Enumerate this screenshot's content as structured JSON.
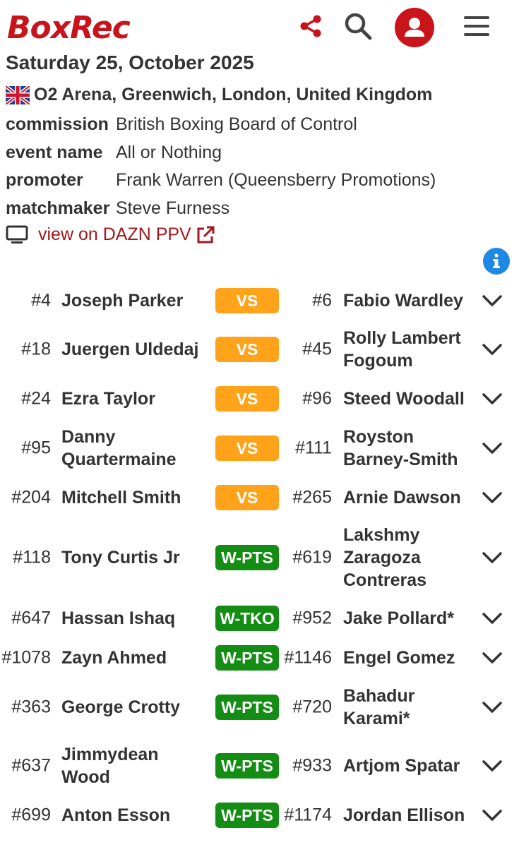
{
  "header": {
    "logo": "BoxRec",
    "icons": [
      "share-icon",
      "search-icon",
      "user-icon",
      "menu-icon"
    ],
    "brand_color": "#c8141a"
  },
  "event": {
    "date": "Saturday 25, October 2025",
    "venue": "O2 Arena, Greenwich, London, United Kingdom",
    "fields": [
      {
        "key": "commission",
        "value": "British Boxing Board of Control"
      },
      {
        "key": "event name",
        "value": "All or Nothing"
      },
      {
        "key": "promoter",
        "value": "Frank Warren (Queensberry Promotions)"
      },
      {
        "key": "matchmaker",
        "value": "Steve Furness"
      }
    ],
    "stream_link": "view on DAZN PPV"
  },
  "colors": {
    "vs": "#ffa31a",
    "win": "#138d13",
    "info": "#1e88e5",
    "link": "#a3171c"
  },
  "bouts": [
    {
      "r1": "#4",
      "n1": "Joseph Parker",
      "result": "VS",
      "r2": "#6",
      "n2": "Fabio Wardley"
    },
    {
      "r1": "#18",
      "n1": "Juergen Uldedaj",
      "result": "VS",
      "r2": "#45",
      "n2": "Rolly Lambert Fogoum"
    },
    {
      "r1": "#24",
      "n1": "Ezra Taylor",
      "result": "VS",
      "r2": "#96",
      "n2": "Steed Woodall"
    },
    {
      "r1": "#95",
      "n1": "Danny Quartermaine",
      "result": "VS",
      "r2": "#111",
      "n2": "Royston Barney-Smith"
    },
    {
      "r1": "#204",
      "n1": "Mitchell Smith",
      "result": "VS",
      "r2": "#265",
      "n2": "Arnie Dawson"
    },
    {
      "r1": "#118",
      "n1": "Tony Curtis Jr",
      "result": "W-PTS",
      "r2": "#619",
      "n2": "Lakshmy Zaragoza Contreras"
    },
    {
      "r1": "#647",
      "n1": "Hassan Ishaq",
      "result": "W-TKO",
      "r2": "#952",
      "n2": "Jake Pollard*"
    },
    {
      "r1": "#1078",
      "n1": "Zayn Ahmed",
      "result": "W-PTS",
      "r2": "#1146",
      "n2": "Engel Gomez"
    },
    {
      "r1": "#363",
      "n1": "George Crotty",
      "result": "W-PTS",
      "r2": "#720",
      "n2": "Bahadur Karami*"
    },
    {
      "r1": "#637",
      "n1": "Jimmydean Wood",
      "result": "W-PTS",
      "r2": "#933",
      "n2": "Artjom Spatar"
    },
    {
      "r1": "#699",
      "n1": "Anton Esson",
      "result": "W-PTS",
      "r2": "#1174",
      "n2": "Jordan Ellison"
    }
  ]
}
